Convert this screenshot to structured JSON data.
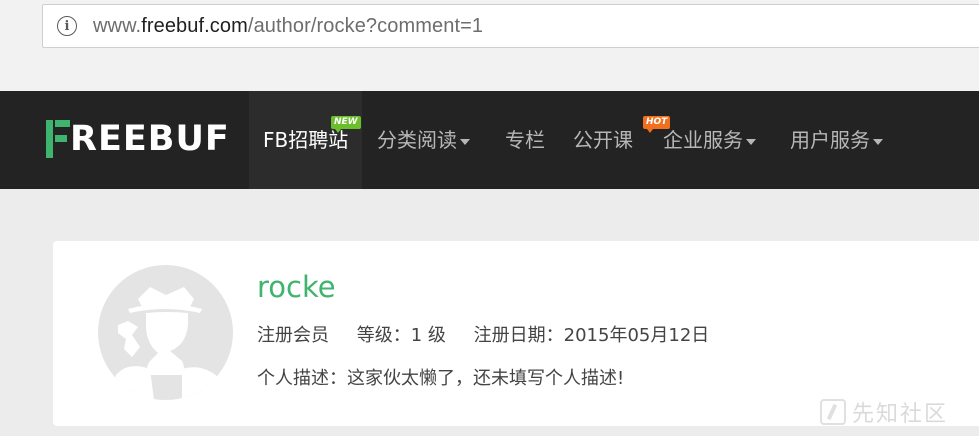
{
  "browser": {
    "url_prefix": "www.",
    "url_domain": "freebuf.com",
    "url_path": "/author/rocke?comment=1",
    "info_icon": "info-icon"
  },
  "nav": {
    "logo": "REEBUF",
    "items": [
      {
        "label": "FB招聘站"
      },
      {
        "label": "分类阅读"
      },
      {
        "label": "专栏"
      },
      {
        "label": "公开课"
      },
      {
        "label": "企业服务"
      },
      {
        "label": "用户服务"
      }
    ],
    "badge_new": "NEW",
    "badge_hot": "HOT"
  },
  "profile": {
    "username": "rocke",
    "member": "注册会员",
    "level": "等级：1 级",
    "reg_date": "注册日期：2015年05月12日",
    "description": "个人描述：这家伙太懒了，还未填写个人描述!"
  },
  "watermark": {
    "text": "先知社区"
  },
  "colors": {
    "accent": "#3fb46e",
    "nav_bg": "#232323",
    "new_badge": "#6cbf2c",
    "hot_badge": "#f0701e"
  }
}
